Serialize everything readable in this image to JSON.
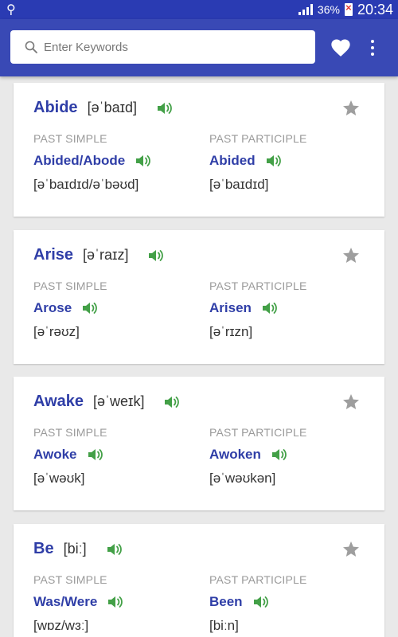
{
  "status_bar": {
    "battery": "36%",
    "time": "20:34"
  },
  "search": {
    "placeholder": "Enter Keywords",
    "value": ""
  },
  "icons": {
    "search": "search-icon",
    "favorites": "heart-icon",
    "menu": "more-vert-icon",
    "sound": "speaker-icon",
    "favorite": "star-icon"
  },
  "colors": {
    "app_bar": "#3949b5",
    "status_bar": "#2a3bb3",
    "word": "#2f3ea7",
    "speaker": "#43a047",
    "star": "#9e9e9e"
  },
  "labels": {
    "past_simple": "PAST SIMPLE",
    "past_participle": "PAST PARTICIPLE"
  },
  "verbs": [
    {
      "base": "Abide",
      "base_ipa": "[əˈbaɪd]",
      "past_simple": "Abided/Abode",
      "past_simple_ipa": "[əˈbaɪdɪd/əˈbəʊd]",
      "past_participle": "Abided",
      "past_participle_ipa": "[əˈbaɪdɪd]"
    },
    {
      "base": "Arise",
      "base_ipa": "[əˈraɪz]",
      "past_simple": "Arose",
      "past_simple_ipa": "[əˈrəʊz]",
      "past_participle": "Arisen",
      "past_participle_ipa": "[əˈrɪzn]"
    },
    {
      "base": "Awake",
      "base_ipa": "[əˈweɪk]",
      "past_simple": "Awoke",
      "past_simple_ipa": "[əˈwəʊk]",
      "past_participle": "Awoken",
      "past_participle_ipa": "[əˈwəʊkən]"
    },
    {
      "base": "Be",
      "base_ipa": "[biː]",
      "past_simple": "Was/Were",
      "past_simple_ipa": "[wɒz/wɜː]",
      "past_participle": "Been",
      "past_participle_ipa": "[biːn]"
    }
  ]
}
